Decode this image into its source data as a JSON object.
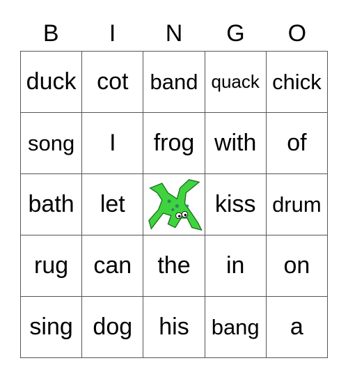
{
  "header": [
    "B",
    "I",
    "N",
    "G",
    "O"
  ],
  "grid": [
    [
      "duck",
      "cot",
      "band",
      "quack",
      "chick"
    ],
    [
      "song",
      "I",
      "frog",
      "with",
      "of"
    ],
    [
      "bath",
      "let",
      "",
      "kiss",
      "drum"
    ],
    [
      "rug",
      "can",
      "the",
      "in",
      "on"
    ],
    [
      "sing",
      "dog",
      "his",
      "bang",
      "a"
    ]
  ],
  "free_space": {
    "icon": "frog-icon",
    "color": "#3fd43f"
  }
}
